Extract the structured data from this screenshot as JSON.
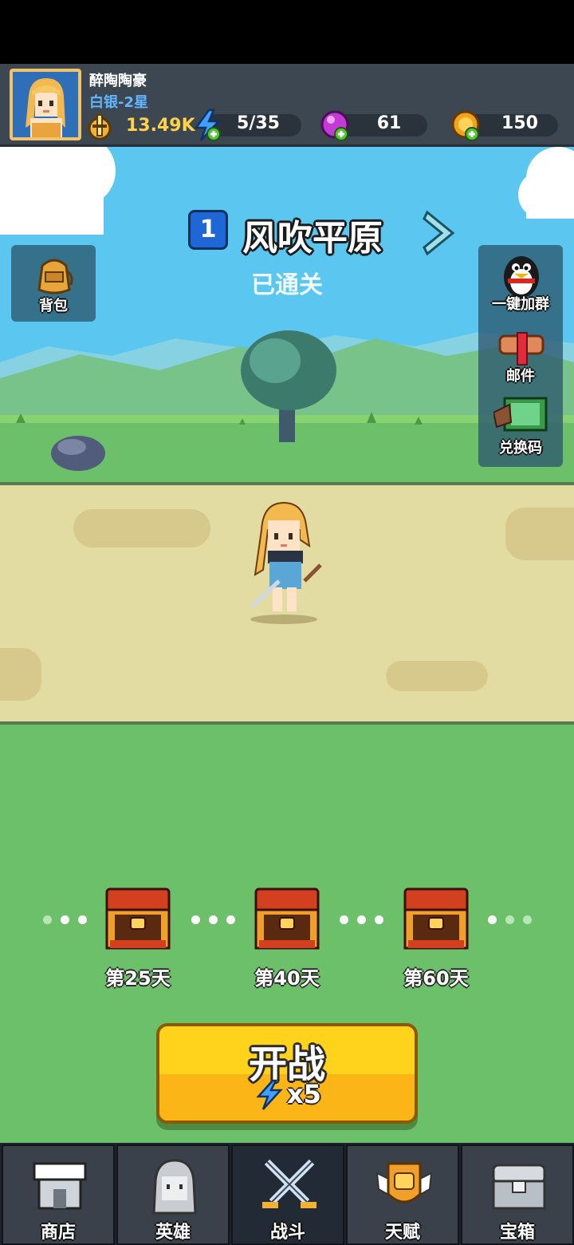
{
  "player": {
    "name": "醉陶陶豪",
    "rank": "白银-2星",
    "power": "13.49K"
  },
  "resources": {
    "energy": "5/35",
    "gems": "61",
    "coins": "150"
  },
  "stage": {
    "number": "1",
    "name": "风吹平原",
    "status": "已通关"
  },
  "side_buttons": {
    "backpack": "背包",
    "join_group": "一键加群",
    "mail": "邮件",
    "redeem_code": "兑换码"
  },
  "rewards": [
    {
      "label": "第25天"
    },
    {
      "label": "第40天"
    },
    {
      "label": "第60天"
    }
  ],
  "battle": {
    "title": "开战",
    "cost": "x5"
  },
  "nav": [
    {
      "label": "商店",
      "icon": "shop-icon"
    },
    {
      "label": "英雄",
      "icon": "hero-icon"
    },
    {
      "label": "战斗",
      "icon": "crossed-swords-icon"
    },
    {
      "label": "天赋",
      "icon": "talent-fist-icon"
    },
    {
      "label": "宝箱",
      "icon": "treasure-chest-icon"
    }
  ],
  "active_tab": "战斗",
  "colors": {
    "topbar": "#3d4752",
    "sky": "#5bc6f0",
    "road": "#e3dca2",
    "field": "#6dc06a",
    "power": "#ffd24a",
    "rank": "#5fb6ff",
    "battle_button": "#ffd21c"
  }
}
